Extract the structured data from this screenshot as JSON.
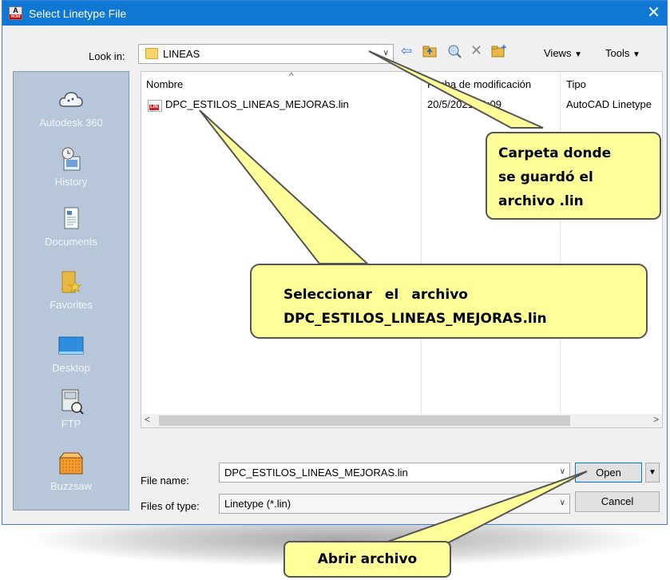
{
  "window": {
    "title": "Select Linetype File",
    "app_icon_letter": "A",
    "app_icon_sub": "m3d",
    "close_symbol": "✕"
  },
  "toolbar": {
    "look_in_label": "Look in:",
    "look_in_value": "LINEAS",
    "views_label": "Views",
    "tools_label": "Tools",
    "icons": [
      "back-arrow-icon",
      "up-folder-icon",
      "search-web-icon",
      "delete-icon",
      "new-folder-icon"
    ]
  },
  "places": [
    {
      "label": "Autodesk 360",
      "icon": "cloud-icon"
    },
    {
      "label": "History",
      "icon": "history-icon"
    },
    {
      "label": "Documents",
      "icon": "documents-icon"
    },
    {
      "label": "Favorites",
      "icon": "favorites-icon"
    },
    {
      "label": "Desktop",
      "icon": "desktop-icon"
    },
    {
      "label": "FTP",
      "icon": "ftp-icon"
    },
    {
      "label": "Buzzsaw",
      "icon": "buzzsaw-icon"
    }
  ],
  "file_list": {
    "columns": [
      "Nombre",
      "Fecha de modificación",
      "Tipo"
    ],
    "rows": [
      {
        "name": "DPC_ESTILOS_LINEAS_MEJORAS.lin",
        "date": "20/5/2021 11:09",
        "type": "AutoCAD Linetype"
      }
    ],
    "file_icon_text": "LIN"
  },
  "file_name": {
    "label": "File name:",
    "value": "DPC_ESTILOS_LINEAS_MEJORAS.lin"
  },
  "file_type": {
    "label": "Files of type:",
    "value": "Linetype (*.lin)"
  },
  "buttons": {
    "open": "Open",
    "cancel": "Cancel"
  },
  "callouts": {
    "folder_line1": "Carpeta donde",
    "folder_line2": "se guardó el",
    "folder_line3": "archivo .lin",
    "select_line1": "Seleccionar el archivo",
    "select_line2": "DPC_ESTILOS_LINEAS_MEJORAS.lin",
    "open": "Abrir archivo"
  },
  "colors": {
    "titlebar": "#0f78d4",
    "callout_fill": "#ffff99",
    "places_bg": "#b7c6d8"
  }
}
